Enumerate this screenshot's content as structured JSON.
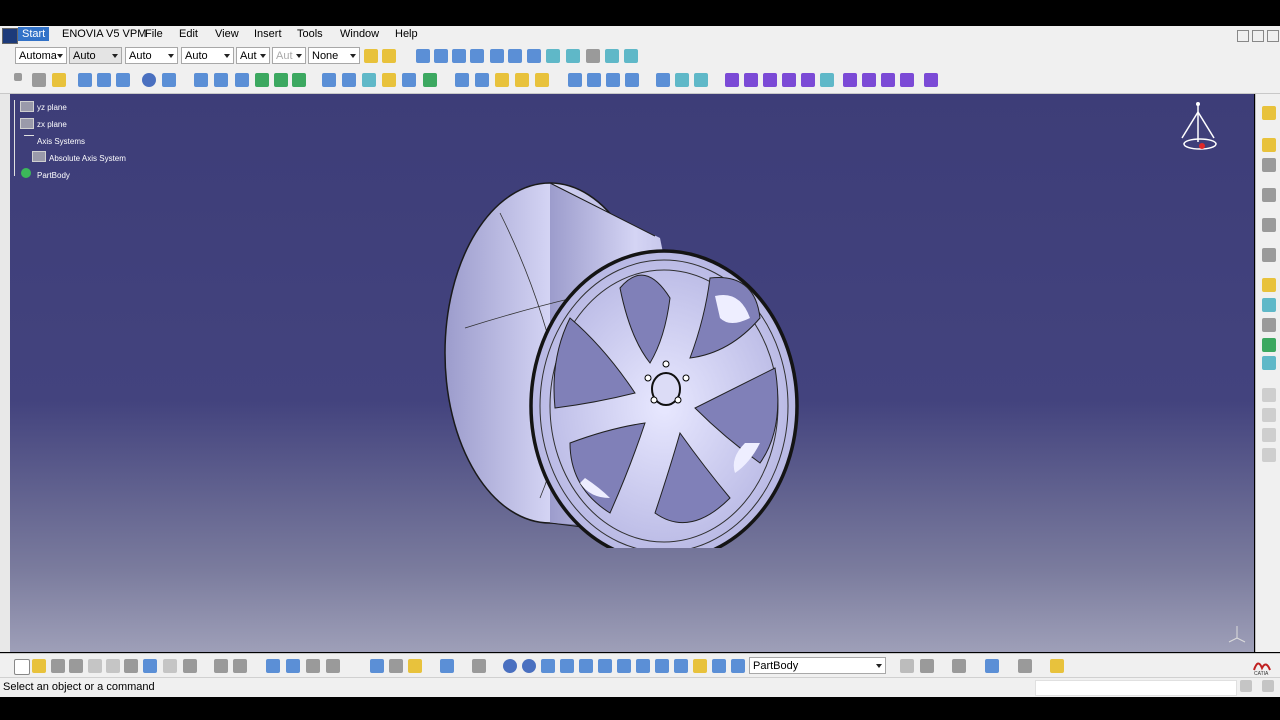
{
  "menu": {
    "start": "Start",
    "enovia": "ENOVIA V5 VPM",
    "file": "File",
    "edit": "Edit",
    "view": "View",
    "insert": "Insert",
    "tools": "Tools",
    "window": "Window",
    "help": "Help"
  },
  "toolbar": {
    "combo1": "Automa",
    "combo2": "Auto",
    "combo3": "Auto",
    "combo4": "Auto",
    "combo5": "Aut",
    "combo6": "Aut",
    "combo7": "None"
  },
  "tree": {
    "yz_plane": "yz plane",
    "zx_plane": "zx plane",
    "axis_systems": "Axis Systems",
    "absolute_axis": "Absolute Axis System",
    "partbody": "PartBody"
  },
  "bottom": {
    "current_body": "PartBody"
  },
  "status": {
    "prompt": "Select an object or a command"
  },
  "colors": {
    "viewport_top": "#3d3d78",
    "viewport_bottom": "#9e9fb8",
    "wheel_face": "#c8c8f0"
  },
  "icons": [
    "catia-logo-icon",
    "compass-icon",
    "axis-triad-icon",
    "catia-brand-icon"
  ]
}
